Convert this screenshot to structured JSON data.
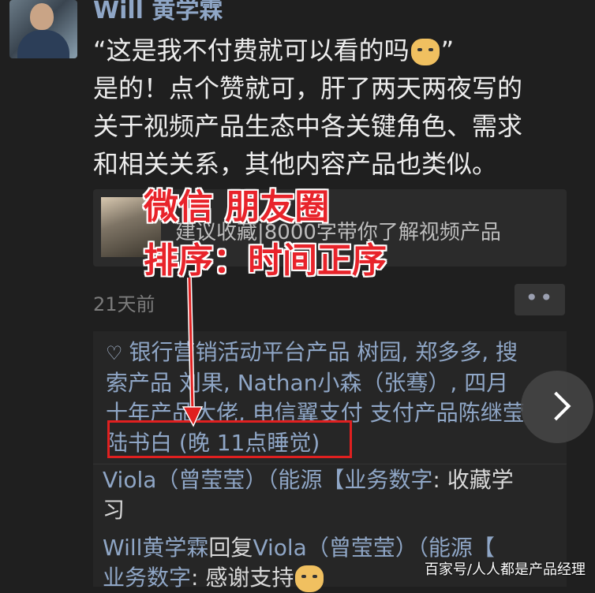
{
  "post": {
    "username": "Will 黄学霖",
    "lines": [
      "“这是我不付费就可以看的吗",
      "是的！点个赞就可，肝了两天两夜写的",
      "关于视频产品生态中各关键角色、需求",
      "和相关关系，其他内容产品也类似。"
    ],
    "line1_close": "”",
    "link_card_title": "建议收藏|8000字带你了解视频产品",
    "timestamp": "21天前",
    "more_button": "••"
  },
  "overlay": {
    "line1": "微信 朋友圈",
    "line2": "排序：时间正序",
    "color": "#e8232a"
  },
  "likes": {
    "lines": [
      "银行营销活动平台产品 树园, 郑多多, 搜",
      "索产品 刘果, Nathan小森（张骞）, 四月",
      "十年产品大佬, 电信翼支付 支付产品陈继莹",
      "陆书白 (晚 11点睡觉)"
    ]
  },
  "comments": [
    {
      "name": "Viola（曾莹莹）（能源【业务数字",
      "text": ": 收藏学",
      "line2": "习"
    },
    {
      "name": "Will黄学霖",
      "reply": "回复",
      "target": "Viola（曾莹莹）（能源【",
      "line2_name": "业务数字",
      "line2_text": ": 感谢支持"
    }
  ],
  "watermark": "百家号/人人都是产品经理"
}
